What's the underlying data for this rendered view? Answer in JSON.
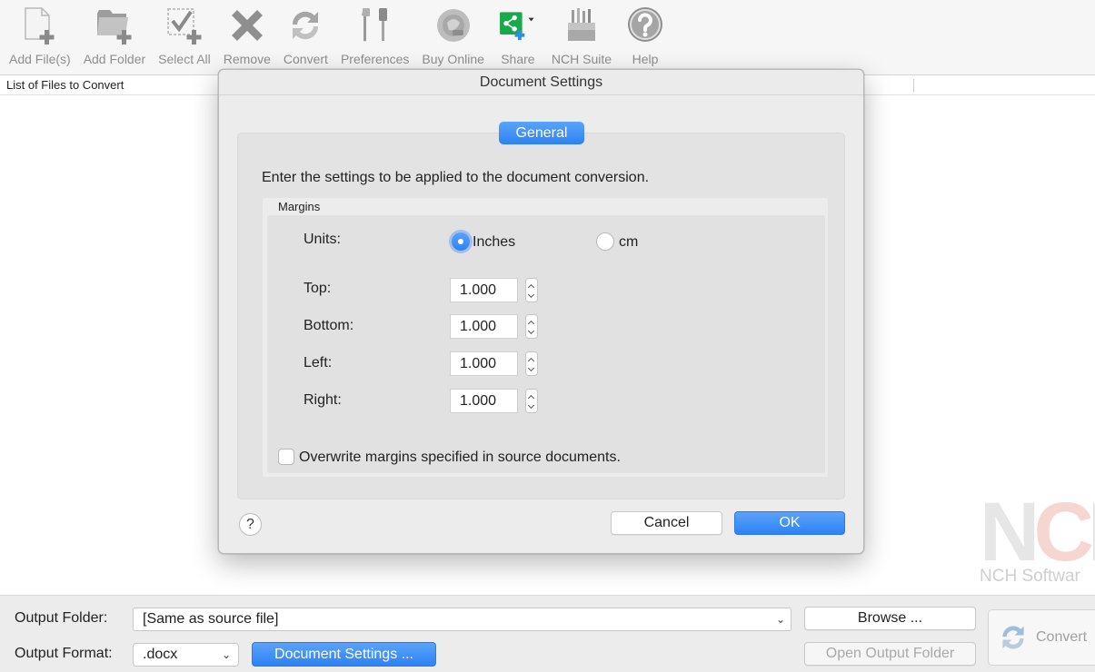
{
  "toolbar": {
    "items": [
      {
        "label": "Add File(s)",
        "icon": "add-file-icon"
      },
      {
        "label": "Add Folder",
        "icon": "add-folder-icon"
      },
      {
        "label": "Select All",
        "icon": "select-all-icon"
      },
      {
        "label": "Remove",
        "icon": "remove-icon"
      },
      {
        "label": "Convert",
        "icon": "convert-icon"
      },
      {
        "label": "Preferences",
        "icon": "preferences-icon"
      },
      {
        "label": "Buy Online",
        "icon": "buy-online-icon"
      },
      {
        "label": "Share",
        "icon": "share-icon"
      },
      {
        "label": "NCH Suite",
        "icon": "nch-suite-icon"
      },
      {
        "label": "Help",
        "icon": "help-icon"
      }
    ]
  },
  "file_list": {
    "header": "List of Files to Convert"
  },
  "watermark": {
    "mark": "NCH",
    "text": "NCH Softwar"
  },
  "bottom": {
    "output_folder_label": "Output Folder:",
    "output_folder_value": "[Same as source file]",
    "browse_label": "Browse ...",
    "output_format_label": "Output Format:",
    "output_format_value": ".docx",
    "document_settings_label": "Document Settings ...",
    "open_output_folder_label": "Open Output Folder",
    "convert_label": "Convert"
  },
  "dialog": {
    "title": "Document Settings",
    "tab_general": "General",
    "intro": "Enter the settings to be applied to the document conversion.",
    "margins_title": "Margins",
    "units_label": "Units:",
    "unit_inches": "Inches",
    "unit_cm": "cm",
    "selected_unit": "Inches",
    "fields": {
      "top": {
        "label": "Top:",
        "value": "1.000"
      },
      "bottom": {
        "label": "Bottom:",
        "value": "1.000"
      },
      "left": {
        "label": "Left:",
        "value": "1.000"
      },
      "right": {
        "label": "Right:",
        "value": "1.000"
      }
    },
    "overwrite_label": "Overwrite margins specified in source documents.",
    "overwrite_checked": false,
    "help_label": "?",
    "cancel_label": "Cancel",
    "ok_label": "OK"
  },
  "colors": {
    "accent_blue": "#2d82f3",
    "share_green": "#1aa84b"
  }
}
